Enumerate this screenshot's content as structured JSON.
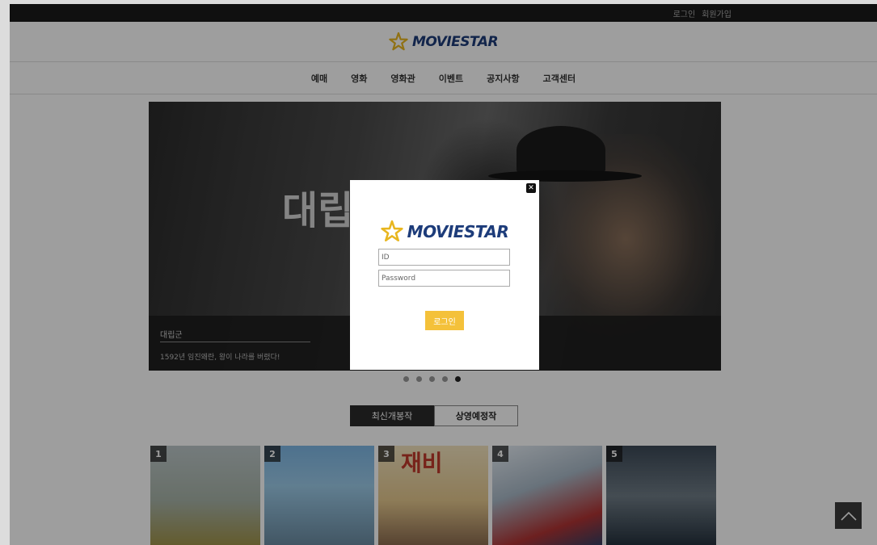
{
  "topbar": {
    "login_link": "로그인",
    "signup_link": "회원가입"
  },
  "header": {
    "logo_text": "MOVIESTAR"
  },
  "nav": {
    "items": [
      "예매",
      "영화",
      "영화관",
      "이벤트",
      "공지사항",
      "고객센터"
    ]
  },
  "hero": {
    "poster_title": "대립군",
    "caption_title": "대립군",
    "caption_desc": "1592년 임진왜란, 왕이 나라를 버렸다!",
    "slide_count": 5,
    "active_slide": 5
  },
  "tabs": {
    "latest": "최신개봉작",
    "upcoming": "상영예정작"
  },
  "posters": [
    {
      "rank": "1",
      "title": ""
    },
    {
      "rank": "2",
      "title": ""
    },
    {
      "rank": "3",
      "title": "재비"
    },
    {
      "rank": "4",
      "title": ""
    },
    {
      "rank": "5",
      "title": ""
    }
  ],
  "modal": {
    "logo_text": "MOVIESTAR",
    "id_placeholder": "ID",
    "password_placeholder": "Password",
    "login_button": "로그인"
  },
  "colors": {
    "accent": "#f4c13a",
    "brand": "#1d3c7a",
    "logo_star": "#e8b61f"
  },
  "icons": {
    "close": "close-icon",
    "scroll_top": "chevron-up-icon",
    "logo": "star-logo-icon"
  }
}
